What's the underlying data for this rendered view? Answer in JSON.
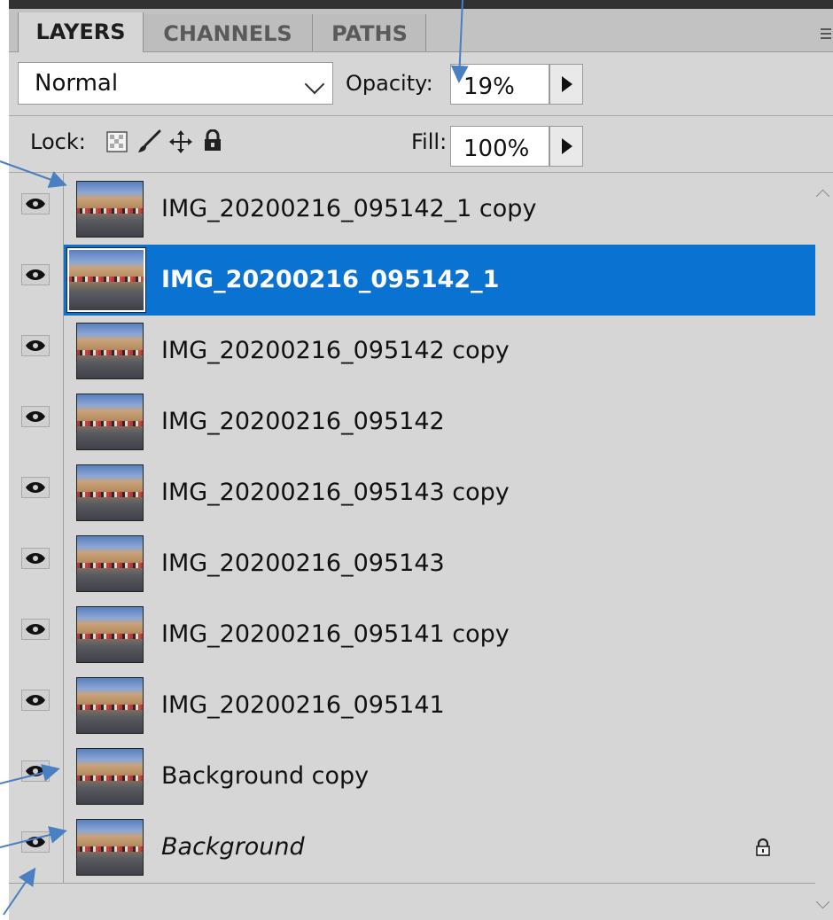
{
  "tabs": [
    {
      "label": "LAYERS",
      "active": true
    },
    {
      "label": "CHANNELS",
      "active": false
    },
    {
      "label": "PATHS",
      "active": false
    }
  ],
  "blend": {
    "mode": "Normal"
  },
  "opacity": {
    "label": "Opacity:",
    "value": "19%"
  },
  "lock": {
    "label": "Lock:"
  },
  "fill": {
    "label": "Fill:",
    "value": "100%"
  },
  "layers": [
    {
      "name": "IMG_20200216_095142_1 copy",
      "selected": false
    },
    {
      "name": "IMG_20200216_095142_1",
      "selected": true
    },
    {
      "name": "IMG_20200216_095142 copy",
      "selected": false
    },
    {
      "name": "IMG_20200216_095142",
      "selected": false
    },
    {
      "name": "IMG_20200216_095143 copy",
      "selected": false
    },
    {
      "name": "IMG_20200216_095143",
      "selected": false
    },
    {
      "name": "IMG_20200216_095141 copy",
      "selected": false
    },
    {
      "name": "IMG_20200216_095141",
      "selected": false
    },
    {
      "name": "Background copy",
      "selected": false
    },
    {
      "name": "Background",
      "selected": false,
      "locked": true
    }
  ],
  "colors": {
    "selected": "#0a72d0",
    "panel": "#d6d6d6",
    "annotation": "#4a7fc1"
  },
  "icons": {
    "eye": "eye-icon",
    "lock_transparent": "checker-icon",
    "lock_image": "brush-icon",
    "lock_position": "move-icon",
    "lock_all": "lock-icon"
  }
}
